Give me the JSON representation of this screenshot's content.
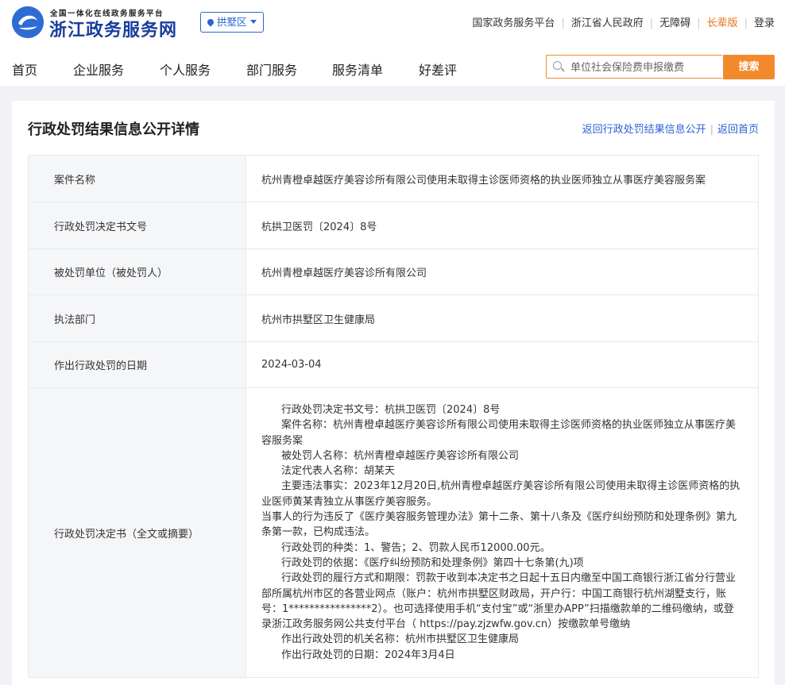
{
  "header": {
    "logo_small": "全国一体化在线政务服务平台",
    "logo_title": "浙江政务服务网",
    "region": "拱墅区",
    "links": [
      "国家政务服务平台",
      "浙江省人民政府",
      "无障碍",
      "长辈版",
      "登录"
    ]
  },
  "nav": {
    "items": [
      "首页",
      "企业服务",
      "个人服务",
      "部门服务",
      "服务清单",
      "好差评"
    ],
    "search_placeholder": "单位社会保险费申报缴费",
    "search_button": "搜索"
  },
  "page": {
    "title": "行政处罚结果信息公开详情",
    "back_to_list": "返回行政处罚结果信息公开",
    "back_home": "返回首页"
  },
  "rows": [
    {
      "label": "案件名称",
      "value": "杭州青橙卓越医疗美容诊所有限公司使用未取得主诊医师资格的执业医师独立从事医疗美容服务案"
    },
    {
      "label": "行政处罚决定书文号",
      "value": "杭拱卫医罚〔2024〕8号"
    },
    {
      "label": "被处罚单位（被处罚人）",
      "value": "杭州青橙卓越医疗美容诊所有限公司"
    },
    {
      "label": "执法部门",
      "value": "杭州市拱墅区卫生健康局"
    },
    {
      "label": "作出行政处罚的日期",
      "value": "2024-03-04"
    }
  ],
  "decision": {
    "label": "行政处罚决定书（全文或摘要）",
    "lines": [
      "行政处罚决定书文号：杭拱卫医罚〔2024〕8号",
      "案件名称：杭州青橙卓越医疗美容诊所有限公司使用未取得主诊医师资格的执业医师独立从事医疗美容服务案",
      "被处罚人名称：杭州青橙卓越医疗美容诊所有限公司",
      "法定代表人名称：胡某天",
      "主要违法事实：2023年12月20日,杭州青橙卓越医疗美容诊所有限公司使用未取得主诊医师资格的执业医师黄某青独立从事医疗美容服务。",
      "当事人的行为违反了《医疗美容服务管理办法》第十二条、第十八条及《医疗纠纷预防和处理条例》第九条第一款，已构成违法。",
      "行政处罚的种类：1、警告；2、罚款人民币12000.00元。",
      "行政处罚的依据：《医疗纠纷预防和处理条例》第四十七条第(九)项",
      "行政处罚的履行方式和期限：罚款于收到本决定书之日起十五日内缴至中国工商银行浙江省分行营业部所属杭州市区的各营业网点（账户：杭州市拱墅区财政局，开户行：中国工商银行杭州湖墅支行，账号：1****************2）。也可选择使用手机“支付宝”或“浙里办APP”扫描缴款单的二维码缴纳，或登录浙江政务服务网公共支付平台（ https://pay.zjzwfw.gov.cn）按缴款单号缴纳",
      "作出行政处罚的机关名称：杭州市拱墅区卫生健康局",
      "作出行政处罚的日期：2024年3月4日"
    ]
  }
}
